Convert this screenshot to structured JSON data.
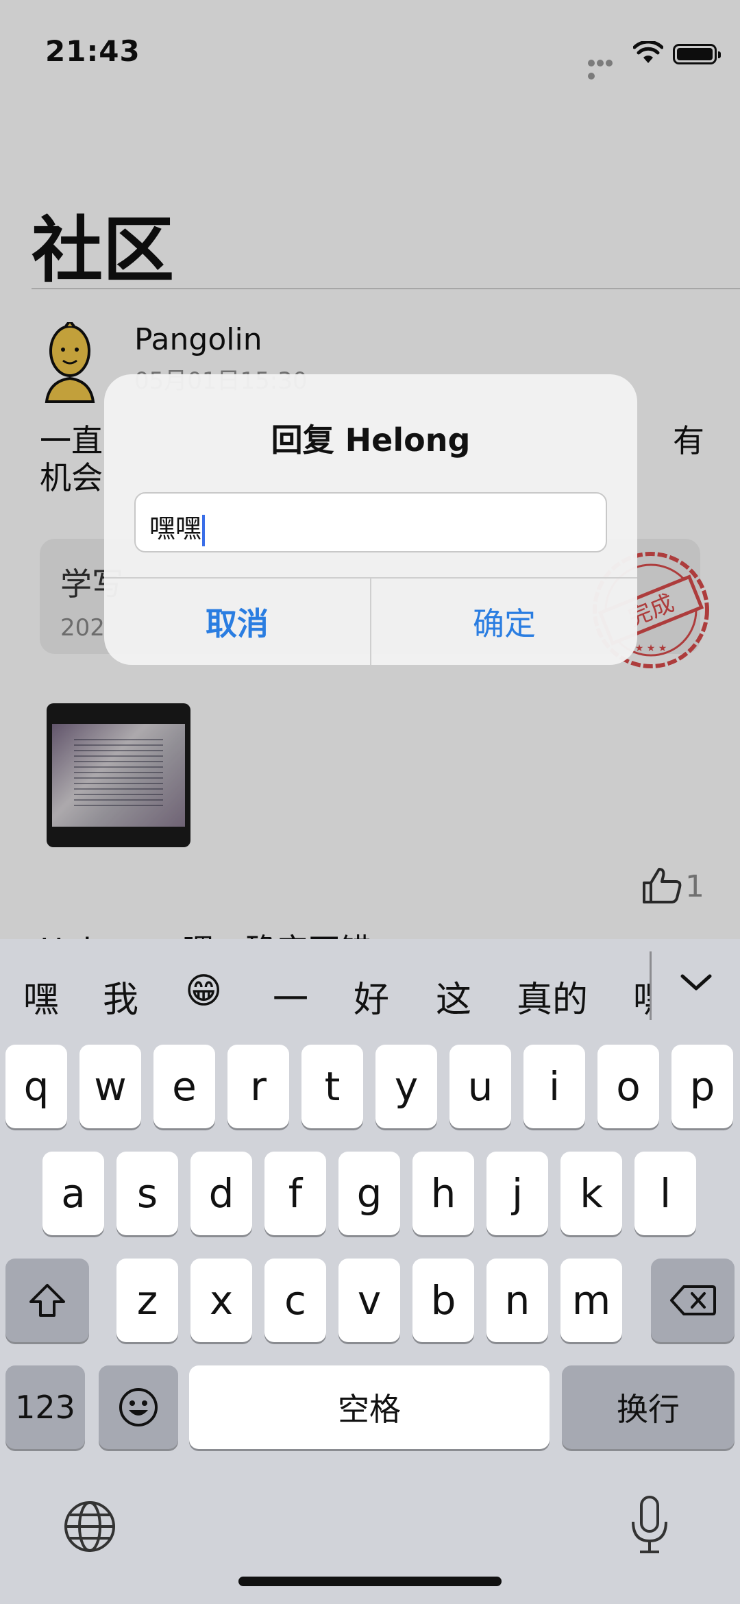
{
  "status_bar": {
    "time": "21:43"
  },
  "page": {
    "title": "社区"
  },
  "post": {
    "username": "Pangolin",
    "time": "05月01日15:30",
    "text_line1_left": "一直",
    "text_line1_right": "有",
    "text_line2": "机会",
    "task_title": "学写",
    "task_date": "202",
    "stamp_text": "完成",
    "likes": "1",
    "comment_peek": "Helong：嘿，确实不错"
  },
  "dialog": {
    "title": "回复 Helong",
    "input_value": "嘿嘿",
    "cancel_label": "取消",
    "confirm_label": "确定"
  },
  "keyboard": {
    "candidates": [
      "嘿",
      "我",
      "😁",
      "一",
      "好",
      "这",
      "真的",
      "嘿"
    ],
    "row1": [
      "q",
      "w",
      "e",
      "r",
      "t",
      "y",
      "u",
      "i",
      "o",
      "p"
    ],
    "row2": [
      "a",
      "s",
      "d",
      "f",
      "g",
      "h",
      "j",
      "k",
      "l"
    ],
    "row3": [
      "z",
      "x",
      "c",
      "v",
      "b",
      "n",
      "m"
    ],
    "numbers_label": "123",
    "space_label": "空格",
    "return_label": "换行"
  },
  "colors": {
    "accent": "#2a7de1",
    "stamp": "#d94b4b"
  }
}
